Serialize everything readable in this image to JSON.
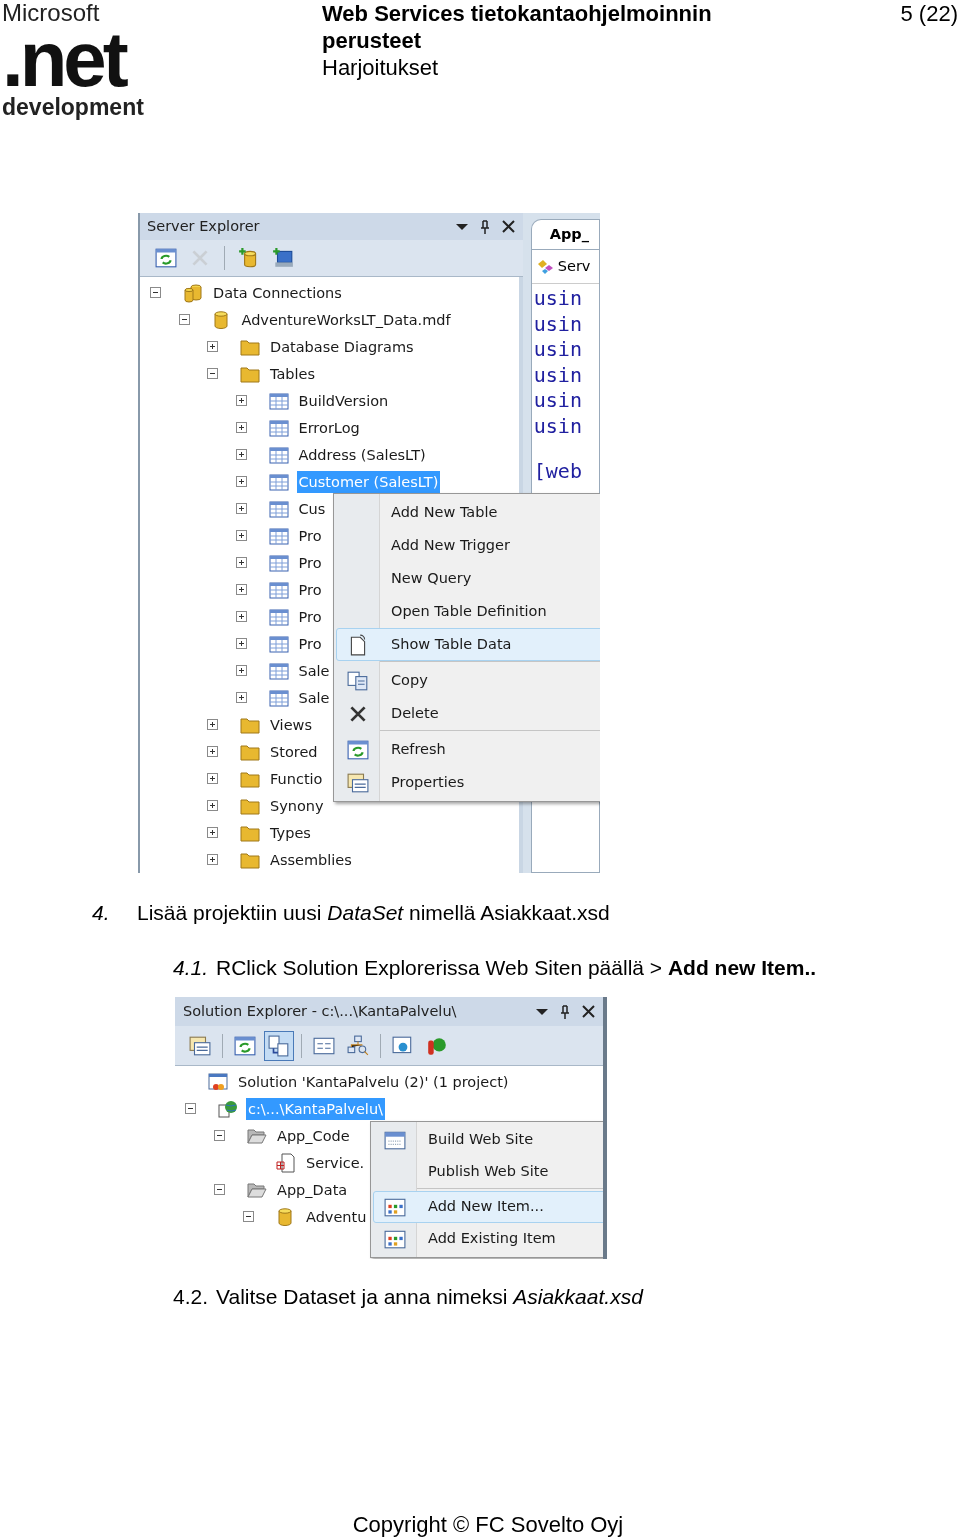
{
  "header": {
    "logo": {
      "brand": "Microsoft",
      "mark": ".net",
      "tagline": "development"
    },
    "title": "Web Services tietokantaohjelmoinnin perusteet",
    "subtitle": "Harjoitukset",
    "page": "5 (22)"
  },
  "server_explorer": {
    "title": "Server Explorer",
    "toolbar": [
      [
        {
          "kind": "refresh",
          "disabled": false
        },
        {
          "kind": "delete",
          "disabled": true
        }
      ],
      [
        {
          "kind": "add-connection",
          "disabled": false
        },
        {
          "kind": "add-server",
          "disabled": false
        }
      ]
    ],
    "tree": [
      {
        "label": "Data Connections",
        "kind": "connections",
        "expanded": true,
        "selected": false,
        "children": [
          {
            "label": "AdventureWorksLT_Data.mdf",
            "kind": "database",
            "expanded": true,
            "selected": false,
            "children": [
              {
                "label": "Database Diagrams",
                "kind": "folder",
                "expanded": false,
                "selected": false
              },
              {
                "label": "Tables",
                "kind": "folder",
                "expanded": true,
                "selected": false,
                "children": [
                  {
                    "label": "BuildVersion",
                    "kind": "table",
                    "expanded": false,
                    "selected": false
                  },
                  {
                    "label": "ErrorLog",
                    "kind": "table",
                    "expanded": false,
                    "selected": false
                  },
                  {
                    "label": "Address (SalesLT)",
                    "kind": "table",
                    "expanded": false,
                    "selected": false
                  },
                  {
                    "label": "Customer (SalesLT)",
                    "kind": "table",
                    "expanded": false,
                    "selected": true
                  },
                  {
                    "label": "Cus",
                    "kind": "table",
                    "expanded": false,
                    "selected": false
                  },
                  {
                    "label": "Pro",
                    "kind": "table",
                    "expanded": false,
                    "selected": false
                  },
                  {
                    "label": "Pro",
                    "kind": "table",
                    "expanded": false,
                    "selected": false
                  },
                  {
                    "label": "Pro",
                    "kind": "table",
                    "expanded": false,
                    "selected": false
                  },
                  {
                    "label": "Pro",
                    "kind": "table",
                    "expanded": false,
                    "selected": false
                  },
                  {
                    "label": "Pro",
                    "kind": "table",
                    "expanded": false,
                    "selected": false
                  },
                  {
                    "label": "Sale",
                    "kind": "table",
                    "expanded": false,
                    "selected": false
                  },
                  {
                    "label": "Sale",
                    "kind": "table",
                    "expanded": false,
                    "selected": false
                  }
                ]
              },
              {
                "label": "Views",
                "kind": "folder",
                "expanded": false,
                "selected": false
              },
              {
                "label": "Stored",
                "kind": "folder",
                "expanded": false,
                "selected": false
              },
              {
                "label": "Functio",
                "kind": "folder",
                "expanded": false,
                "selected": false
              },
              {
                "label": "Synony",
                "kind": "folder",
                "expanded": false,
                "selected": false
              },
              {
                "label": "Types",
                "kind": "folder",
                "expanded": false,
                "selected": false
              },
              {
                "label": "Assemblies",
                "kind": "folder",
                "expanded": false,
                "selected": false
              }
            ]
          }
        ]
      }
    ],
    "editor": {
      "tab": "App_",
      "header": "Serv",
      "lines": [
        "usin",
        "usin",
        "usin",
        "usin",
        "usin",
        "usin",
        "[web"
      ]
    },
    "context_menu": [
      {
        "label": "Add New Table",
        "kind": "plain",
        "selected": false,
        "separator_before": false
      },
      {
        "label": "Add New Trigger",
        "kind": "plain",
        "selected": false,
        "separator_before": false
      },
      {
        "label": "New Query",
        "kind": "plain",
        "selected": false,
        "separator_before": false
      },
      {
        "label": "Open Table Definition",
        "kind": "plain",
        "selected": false,
        "separator_before": false
      },
      {
        "label": "Show Table Data",
        "kind": "showdata",
        "selected": true,
        "separator_before": false
      },
      {
        "label": "Copy",
        "kind": "copy",
        "selected": false,
        "separator_before": true
      },
      {
        "label": "Delete",
        "kind": "delete",
        "selected": false,
        "separator_before": false
      },
      {
        "label": "Refresh",
        "kind": "refresh",
        "selected": false,
        "separator_before": true
      },
      {
        "label": "Properties",
        "kind": "properties",
        "selected": false,
        "separator_before": false
      }
    ]
  },
  "steps": [
    {
      "number": "4.",
      "number_italic": true,
      "kind": "step",
      "text": "Lisää projektiin uusi *DataSet* nimellä Asiakkaat.xsd"
    },
    {
      "number": "4.1.",
      "number_italic": true,
      "kind": "substep",
      "text": "RClick Solution Explorerissa Web Siten päällä > **Add new Item..**"
    },
    {
      "number": "4.2.",
      "number_italic": false,
      "kind": "substep",
      "text": "Valitse Dataset ja anna nimeksi *Asiakkaat.xsd*"
    }
  ],
  "solution_explorer": {
    "title": "Solution Explorer - c:\\...\\KantaPalvelu\\",
    "toolbar": [
      [
        {
          "kind": "properties",
          "pressed": false
        }
      ],
      [
        {
          "kind": "refresh",
          "pressed": false
        },
        {
          "kind": "nest",
          "pressed": true
        }
      ],
      [
        {
          "kind": "view-code",
          "pressed": false
        },
        {
          "kind": "class-diagram",
          "pressed": false
        }
      ],
      [
        {
          "kind": "browser",
          "pressed": false
        },
        {
          "kind": "config",
          "pressed": false
        }
      ]
    ],
    "tree": [
      {
        "label": "Solution 'KantaPalvelu (2)' (1 project)",
        "kind": "solution",
        "selected": false,
        "children": [
          {
            "label": "c:\\...\\KantaPalvelu\\",
            "kind": "website",
            "expanded": true,
            "selected": true,
            "children": [
              {
                "label": "App_Code",
                "kind": "open-folder",
                "expanded": true,
                "selected": false,
                "children": [
                  {
                    "label": "Service.",
                    "kind": "code-file",
                    "selected": false
                  }
                ]
              },
              {
                "label": "App_Data",
                "kind": "open-folder",
                "expanded": true,
                "selected": false,
                "children": [
                  {
                    "label": "Adventu",
                    "kind": "database",
                    "expanded": true,
                    "selected": false
                  }
                ]
              }
            ]
          }
        ]
      }
    ],
    "context_menu": [
      {
        "label": "Build Web Site",
        "kind": "build",
        "selected": false,
        "separator_before": false
      },
      {
        "label": "Publish Web Site",
        "kind": "plain",
        "selected": false,
        "separator_before": false
      },
      {
        "label": "Add New Item...",
        "kind": "additem",
        "selected": true,
        "separator_before": true
      },
      {
        "label": "Add Existing Item",
        "kind": "additem",
        "selected": false,
        "separator_before": false
      }
    ]
  },
  "footer": "Copyright © FC Sovelto Oyj"
}
